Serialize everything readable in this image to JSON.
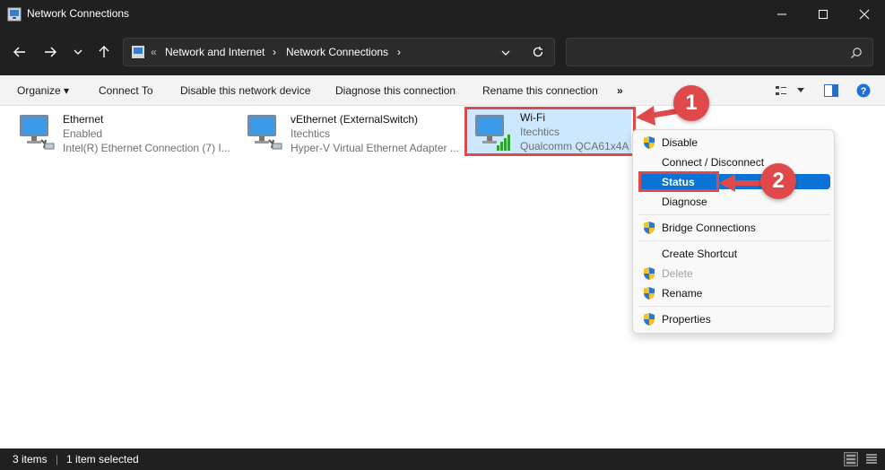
{
  "window": {
    "title": "Network Connections",
    "icons": {
      "app": "network-connections-icon",
      "minimize": "minimize-icon",
      "maximize": "maximize-icon",
      "close": "close-icon"
    }
  },
  "nav": {
    "icons": [
      "back-arrow-icon",
      "forward-arrow-icon",
      "recent-chevron-icon",
      "up-arrow-icon"
    ]
  },
  "address": {
    "chevrons": "«",
    "crumbs": [
      "Network and Internet",
      "Network Connections"
    ],
    "separator": "›",
    "icons": {
      "location": "control-panel-icon",
      "dropdown": "chevron-down-icon",
      "refresh": "refresh-icon"
    }
  },
  "search": {
    "placeholder": "",
    "icon": "search-icon"
  },
  "toolbar": {
    "organize": "Organize ▾",
    "connect": "Connect To",
    "disable": "Disable this network device",
    "diagnose": "Diagnose this connection",
    "rename": "Rename this connection",
    "more": "»",
    "icons": {
      "view": "change-view-icon",
      "view_menu": "chevron-down-icon",
      "preview": "preview-pane-icon",
      "help": "help-icon"
    }
  },
  "connections": [
    {
      "name": "Ethernet",
      "status": "Enabled",
      "device": "Intel(R) Ethernet Connection (7) I...",
      "icon": "ethernet-adapter-icon"
    },
    {
      "name": "vEthernet (ExternalSwitch)",
      "status": "Itechtics",
      "device": "Hyper-V Virtual Ethernet Adapter ...",
      "icon": "ethernet-adapter-icon"
    },
    {
      "name": "Wi-Fi",
      "status": "Itechtics",
      "device": "Qualcomm QCA61x4A",
      "icon": "wifi-adapter-icon",
      "selected": true
    }
  ],
  "context_menu": {
    "items": [
      {
        "label": "Disable",
        "shield": true
      },
      {
        "label": "Connect / Disconnect",
        "shield": false
      },
      {
        "label": "Status",
        "shield": false,
        "highlighted": true
      },
      {
        "label": "Diagnose",
        "shield": false
      },
      {
        "label": "Bridge Connections",
        "shield": true
      },
      {
        "label": "Create Shortcut",
        "shield": false
      },
      {
        "label": "Delete",
        "shield": true,
        "disabled": true
      },
      {
        "label": "Rename",
        "shield": true
      },
      {
        "label": "Properties",
        "shield": true
      }
    ]
  },
  "annotations": {
    "step1": "1",
    "step2": "2",
    "color": "#e0494a"
  },
  "status": {
    "items": "3 items",
    "selected": "1 item selected",
    "icons": {
      "details_view": "details-view-icon",
      "tiles_view": "tiles-view-icon"
    }
  }
}
